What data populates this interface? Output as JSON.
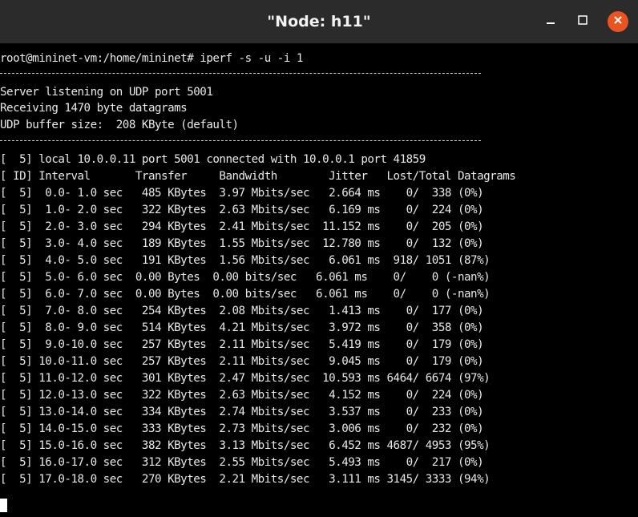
{
  "window": {
    "title": "\"Node: h11\""
  },
  "icons": {
    "minimize": "minimize-icon",
    "maximize": "maximize-icon",
    "close": "close-icon",
    "close_bg": "#e95420"
  },
  "terminal": {
    "prompt_line": "root@mininet-vm:/home/mininet# iperf -s -u -i 1",
    "separator": "------------------------------------------------------------",
    "header_lines": [
      "Server listening on UDP port 5001",
      "Receiving 1470 byte datagrams",
      "UDP buffer size:  208 KByte (default)"
    ],
    "connection_line": "[  5] local 10.0.0.11 port 5001 connected with 10.0.0.1 port 41859",
    "column_header": "[ ID] Interval       Transfer     Bandwidth        Jitter   Lost/Total Datagrams",
    "rows": [
      "[  5]  0.0- 1.0 sec   485 KBytes  3.97 Mbits/sec   2.664 ms    0/  338 (0%)",
      "[  5]  1.0- 2.0 sec   322 KBytes  2.63 Mbits/sec   6.169 ms    0/  224 (0%)",
      "[  5]  2.0- 3.0 sec   294 KBytes  2.41 Mbits/sec  11.152 ms    0/  205 (0%)",
      "[  5]  3.0- 4.0 sec   189 KBytes  1.55 Mbits/sec  12.780 ms    0/  132 (0%)",
      "[  5]  4.0- 5.0 sec   191 KBytes  1.56 Mbits/sec   6.061 ms  918/ 1051 (87%)",
      "[  5]  5.0- 6.0 sec  0.00 Bytes  0.00 bits/sec   6.061 ms    0/    0 (-nan%)",
      "[  5]  6.0- 7.0 sec  0.00 Bytes  0.00 bits/sec   6.061 ms    0/    0 (-nan%)",
      "[  5]  7.0- 8.0 sec   254 KBytes  2.08 Mbits/sec   1.413 ms    0/  177 (0%)",
      "[  5]  8.0- 9.0 sec   514 KBytes  4.21 Mbits/sec   3.972 ms    0/  358 (0%)",
      "[  5]  9.0-10.0 sec   257 KBytes  2.11 Mbits/sec   5.419 ms    0/  179 (0%)",
      "[  5] 10.0-11.0 sec   257 KBytes  2.11 Mbits/sec   9.045 ms    0/  179 (0%)",
      "[  5] 11.0-12.0 sec   301 KBytes  2.47 Mbits/sec  10.593 ms 6464/ 6674 (97%)",
      "[  5] 12.0-13.0 sec   322 KBytes  2.63 Mbits/sec   4.152 ms    0/  224 (0%)",
      "[  5] 13.0-14.0 sec   334 KBytes  2.74 Mbits/sec   3.537 ms    0/  233 (0%)",
      "[  5] 14.0-15.0 sec   333 KBytes  2.73 Mbits/sec   3.006 ms    0/  232 (0%)",
      "[  5] 15.0-16.0 sec   382 KBytes  3.13 Mbits/sec   6.452 ms 4687/ 4953 (95%)",
      "[  5] 16.0-17.0 sec   312 KBytes  2.55 Mbits/sec   5.493 ms    0/  217 (0%)",
      "[  5] 17.0-18.0 sec   270 KBytes  2.21 Mbits/sec   3.111 ms 3145/ 3333 (94%)"
    ]
  }
}
